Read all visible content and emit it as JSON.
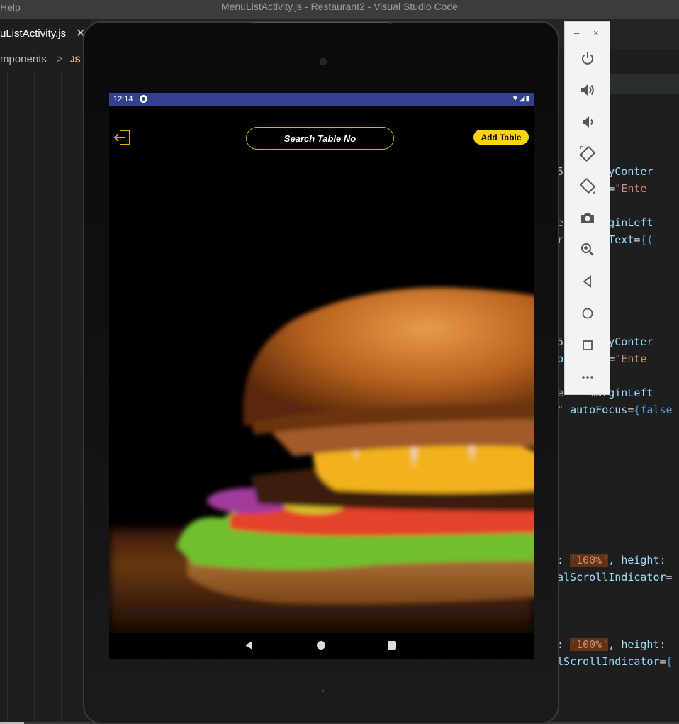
{
  "vscode": {
    "menu_help": "Help",
    "window_title": "MenuListActivity.js - Restaurant2 - Visual Studio Code",
    "active_tab": "uListActivity.js",
    "tab_close": "✕",
    "breadcrumb": {
      "folder": "mponents",
      "separator": ">",
      "file_badge": "JS"
    }
  },
  "emulator": {
    "statusbar": {
      "time": "12:14",
      "icons": "▼◢▮"
    },
    "app": {
      "search_placeholder": "Search Table No",
      "add_table_label": "Add Table"
    },
    "toolbar": {
      "minimize": "–",
      "close": "×",
      "buttons": [
        "power-icon",
        "volume-up-icon",
        "volume-down-icon",
        "rotate-left-icon",
        "rotate-right-icon",
        "camera-icon",
        "zoom-icon",
        "back-icon",
        "home-icon",
        "overview-icon",
        "more-icon"
      ]
    }
  },
  "colors": {
    "statusbar": "#32408f",
    "accent_yellow": "#ffd400",
    "search_border": "#e0b000"
  }
}
